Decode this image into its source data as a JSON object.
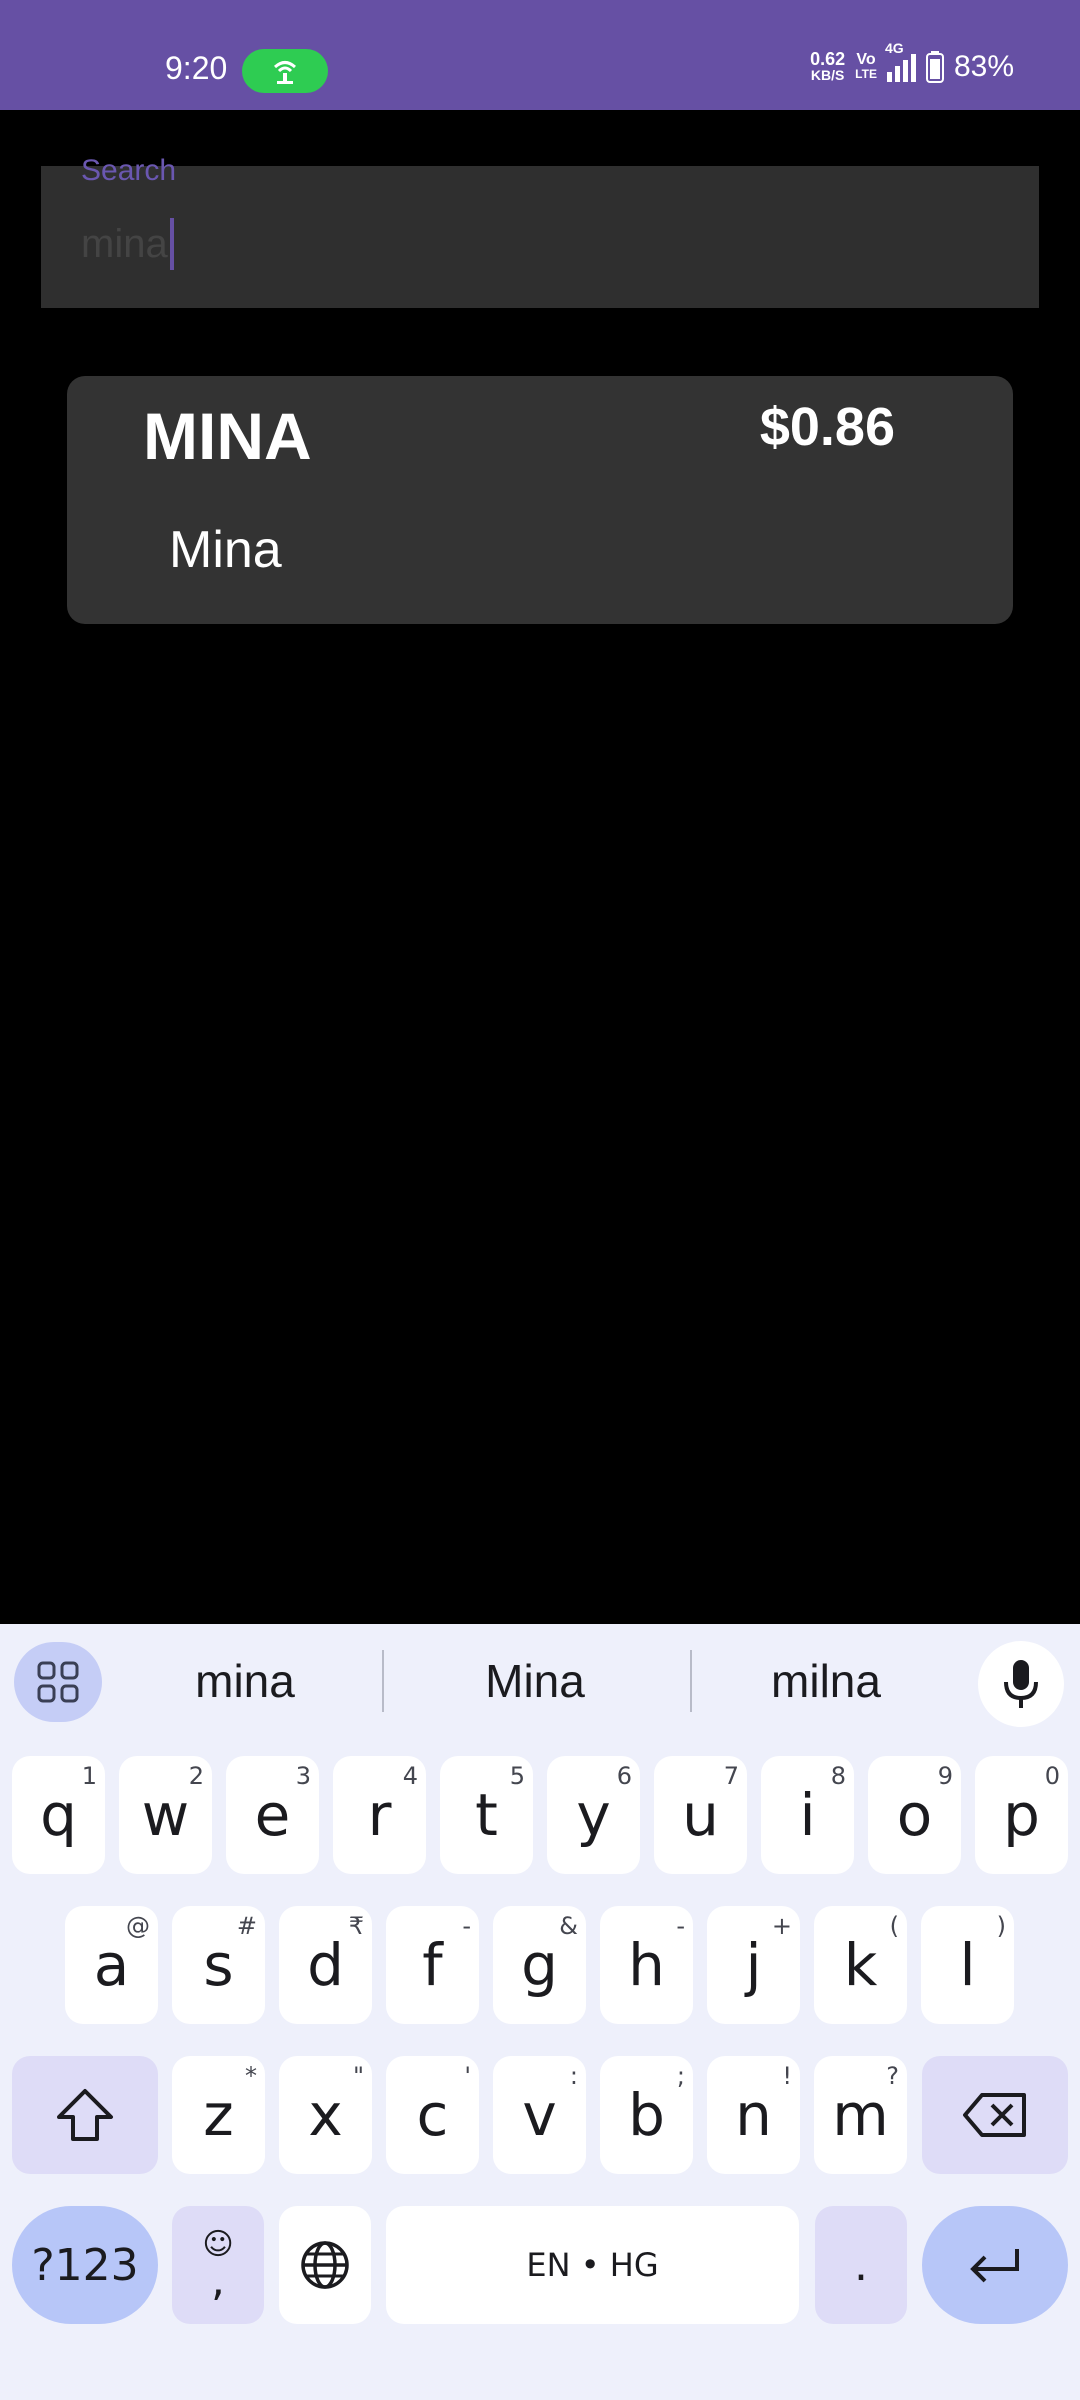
{
  "status_bar": {
    "time": "9:20",
    "net_speed_value": "0.62",
    "net_speed_unit": "KB/S",
    "volte_top": "Vo",
    "volte_bottom": "LTE",
    "network": "4G",
    "battery": "83%"
  },
  "search": {
    "label": "Search",
    "value": "mina"
  },
  "results": [
    {
      "symbol": "MINA",
      "price": "$0.86",
      "name": "Mina"
    }
  ],
  "keyboard": {
    "suggestions": [
      "mina",
      "Mina",
      "milna"
    ],
    "row1": [
      {
        "k": "q",
        "h": "1"
      },
      {
        "k": "w",
        "h": "2"
      },
      {
        "k": "e",
        "h": "3"
      },
      {
        "k": "r",
        "h": "4"
      },
      {
        "k": "t",
        "h": "5"
      },
      {
        "k": "y",
        "h": "6"
      },
      {
        "k": "u",
        "h": "7"
      },
      {
        "k": "i",
        "h": "8"
      },
      {
        "k": "o",
        "h": "9"
      },
      {
        "k": "p",
        "h": "0"
      }
    ],
    "row2": [
      {
        "k": "a",
        "h": "@"
      },
      {
        "k": "s",
        "h": "#"
      },
      {
        "k": "d",
        "h": "₹"
      },
      {
        "k": "f",
        "h": "-"
      },
      {
        "k": "g",
        "h": "&"
      },
      {
        "k": "h",
        "h": "-"
      },
      {
        "k": "j",
        "h": "+"
      },
      {
        "k": "k",
        "h": "("
      },
      {
        "k": "l",
        "h": ")"
      }
    ],
    "row3": [
      {
        "k": "z",
        "h": "*"
      },
      {
        "k": "x",
        "h": "\""
      },
      {
        "k": "c",
        "h": "'"
      },
      {
        "k": "v",
        "h": ":"
      },
      {
        "k": "b",
        "h": ";"
      },
      {
        "k": "n",
        "h": "!"
      },
      {
        "k": "m",
        "h": "?"
      }
    ],
    "symbols_label": "?123",
    "comma_label": ",",
    "space_label": "EN • HG",
    "period_label": "."
  },
  "colors": {
    "status_bar": "#6650a4",
    "hotspot": "#2ecc52",
    "card": "#333333",
    "keyboard_bg": "#eef0fb"
  }
}
